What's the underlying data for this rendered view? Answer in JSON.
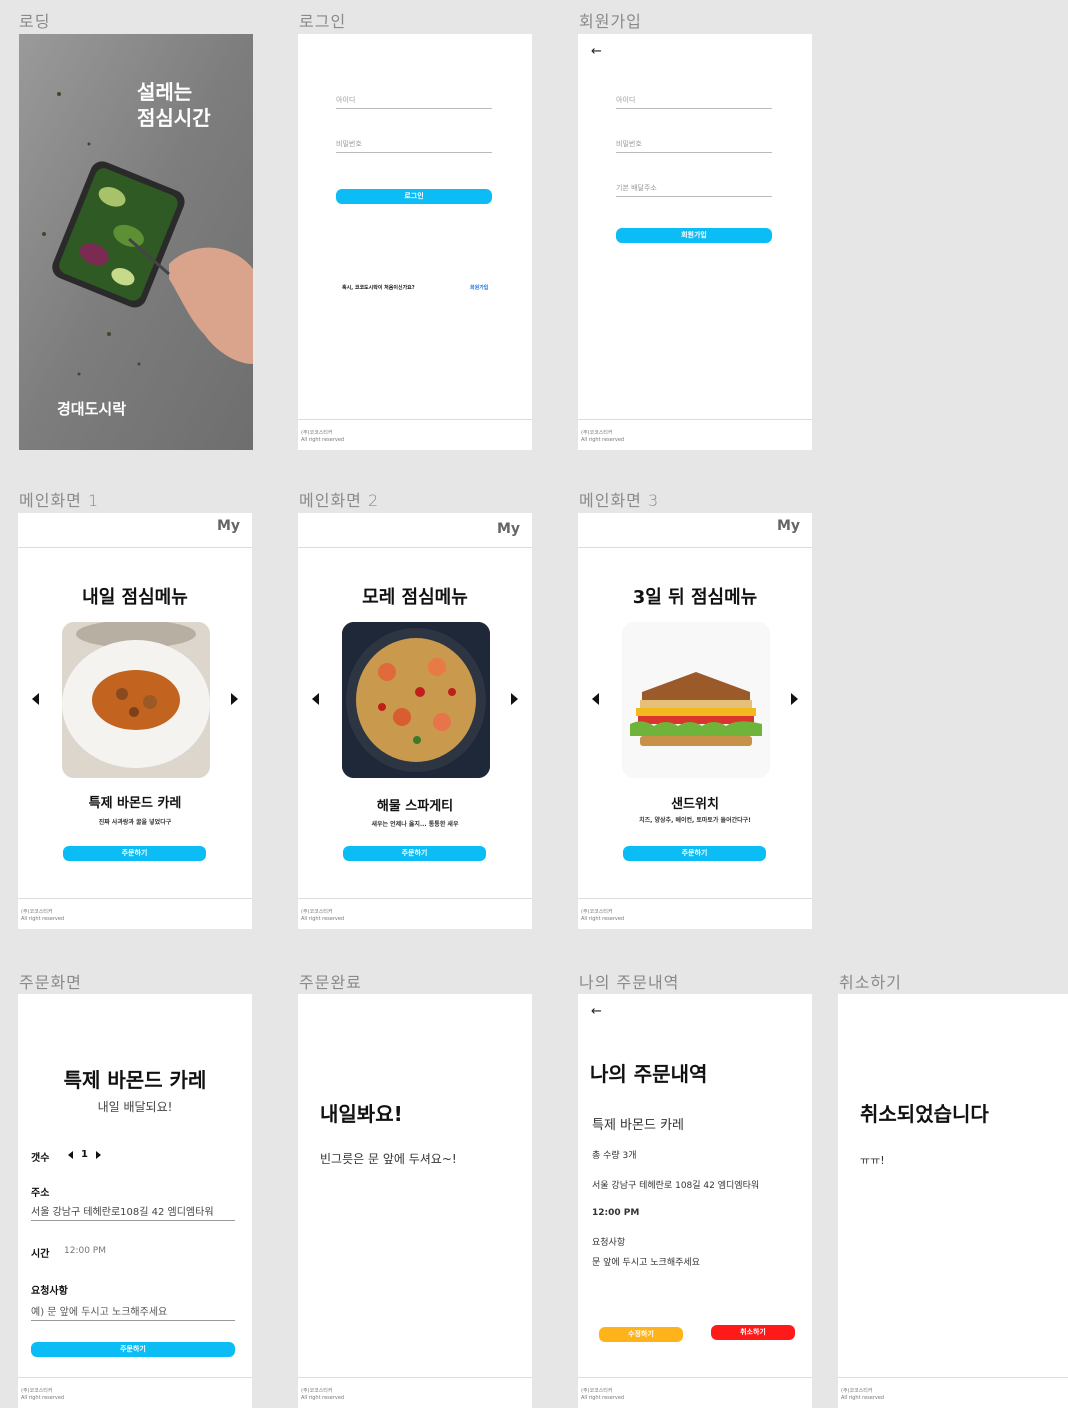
{
  "labels": {
    "loading": "로딩",
    "login": "로그인",
    "signup": "회원가입",
    "main1": "메인화면 1",
    "main2": "메인화면 2",
    "main3": "메인화면 3",
    "order": "주문화면",
    "complete": "주문완료",
    "history": "나의 주문내역",
    "cancel": "취소하기"
  },
  "footer": {
    "line1": "(주)코코스티커",
    "line2": "All right reserved"
  },
  "loading": {
    "headline_1": "설레는",
    "headline_2": "점심시간",
    "brand": "경대도시락"
  },
  "login": {
    "id_placeholder": "아이디",
    "pw_placeholder": "비밀번호",
    "button": "로그인",
    "prompt": "혹시, 코코도시락이 처음이신가요?",
    "signup_link": "회원가입"
  },
  "signup": {
    "back_icon": "←",
    "id_placeholder": "아이디",
    "pw_placeholder": "비밀번호",
    "address_placeholder": "기본 배달주소",
    "button": "회원가입"
  },
  "menus": [
    {
      "my": "My",
      "title": "내일 점심메뉴",
      "name": "특제 바몬드 카레",
      "desc": "진짜 사과랑과 꿀을 넣었다구",
      "button": "주문하기"
    },
    {
      "my": "My",
      "title": "모레 점심메뉴",
      "name": "해물 스파게티",
      "desc": "새우는 언제나 옳지... 통통한 새우",
      "button": "주문하기"
    },
    {
      "my": "My",
      "title": "3일 뒤 점심메뉴",
      "name": "샌드위치",
      "desc": "치즈, 양상추, 베이컨, 토마토가 들어간다구!",
      "button": "주문하기"
    }
  ],
  "order": {
    "title": "특제 바몬드 카레",
    "subtitle": "내일 배달되요!",
    "qty_label": "갯수",
    "qty_value": "1",
    "addr_label": "주소",
    "addr_value": "서울 강남구 테헤란로108길 42 엠디엠타워",
    "time_label": "시간",
    "time_value": "12:00 PM",
    "req_label": "요청사항",
    "req_placeholder": "예) 문 앞에 두시고 노크해주세요",
    "button": "주문하기"
  },
  "complete": {
    "title": "내일봐요!",
    "message": "빈그릇은 문 앞에 두셔요~!"
  },
  "history": {
    "back_icon": "←",
    "title": "나의 주문내역",
    "item": "특제 바몬드 카레",
    "qty": "총 수량 3개",
    "addr": "서울 강남구 테헤란로 108길 42 엠디엠타워",
    "time": "12:00 PM",
    "req_label": "요청사항",
    "req_value": "문 앞에 두시고 노크해주세요",
    "edit_button": "수정하기",
    "cancel_button": "취소하기"
  },
  "cancelled": {
    "title": "취소되었습니다",
    "message": "ㅠㅠ!"
  },
  "colors": {
    "accent": "#0bbcf5",
    "edit": "#ffb31a",
    "cancel": "#ff1a1a"
  }
}
